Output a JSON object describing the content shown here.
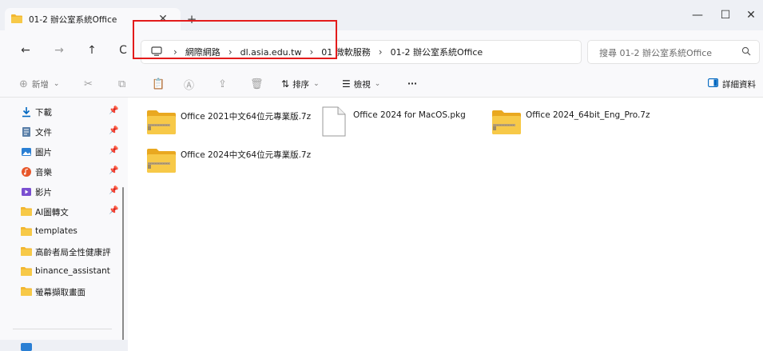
{
  "window": {
    "tab_title": "01-2 辦公室系統Office",
    "tab_close": "✕",
    "new_tab": "+",
    "minimize": "—",
    "maximize": "☐",
    "close": "✕"
  },
  "nav": {
    "back": "←",
    "forward": "→",
    "up": "↑",
    "refresh": "C"
  },
  "address": {
    "breadcrumbs": [
      "網際網路",
      "dl.asia.edu.tw",
      "01 微軟服務",
      "01-2 辦公室系統Office"
    ],
    "separator": "›"
  },
  "search": {
    "placeholder": "搜尋 01-2 辦公室系統Office"
  },
  "toolbar": {
    "new": "新增",
    "sort": "排序",
    "view": "檢視",
    "more": "···",
    "details": "詳細資料"
  },
  "sidebar": {
    "items": [
      {
        "label": "下載",
        "icon": "download-icon",
        "pinned": true
      },
      {
        "label": "文件",
        "icon": "document-icon",
        "pinned": true
      },
      {
        "label": "圖片",
        "icon": "picture-icon",
        "pinned": true
      },
      {
        "label": "音樂",
        "icon": "music-icon",
        "pinned": true
      },
      {
        "label": "影片",
        "icon": "video-icon",
        "pinned": true
      },
      {
        "label": "AI圖轉文",
        "icon": "folder-icon",
        "pinned": true
      },
      {
        "label": "templates",
        "icon": "folder-icon",
        "pinned": false
      },
      {
        "label": "高齡者局全性健康評",
        "icon": "folder-icon",
        "pinned": false
      },
      {
        "label": "binance_assistant",
        "icon": "folder-icon",
        "pinned": false
      },
      {
        "label": "螢幕擷取畫面",
        "icon": "folder-icon",
        "pinned": false
      }
    ]
  },
  "files": [
    {
      "name": "Office 2021中文64位元專業版.7z",
      "type": "zip-folder-icon"
    },
    {
      "name": "Office 2024 for MacOS.pkg",
      "type": "file-icon"
    },
    {
      "name": "Office 2024_64bit_Eng_Pro.7z",
      "type": "zip-folder-icon"
    },
    {
      "name": "Office 2024中文64位元專業版.7z",
      "type": "zip-folder-icon"
    }
  ],
  "colors": {
    "highlight": "#e31b1b",
    "folder": "#f2b731",
    "accent": "#0067c0"
  }
}
